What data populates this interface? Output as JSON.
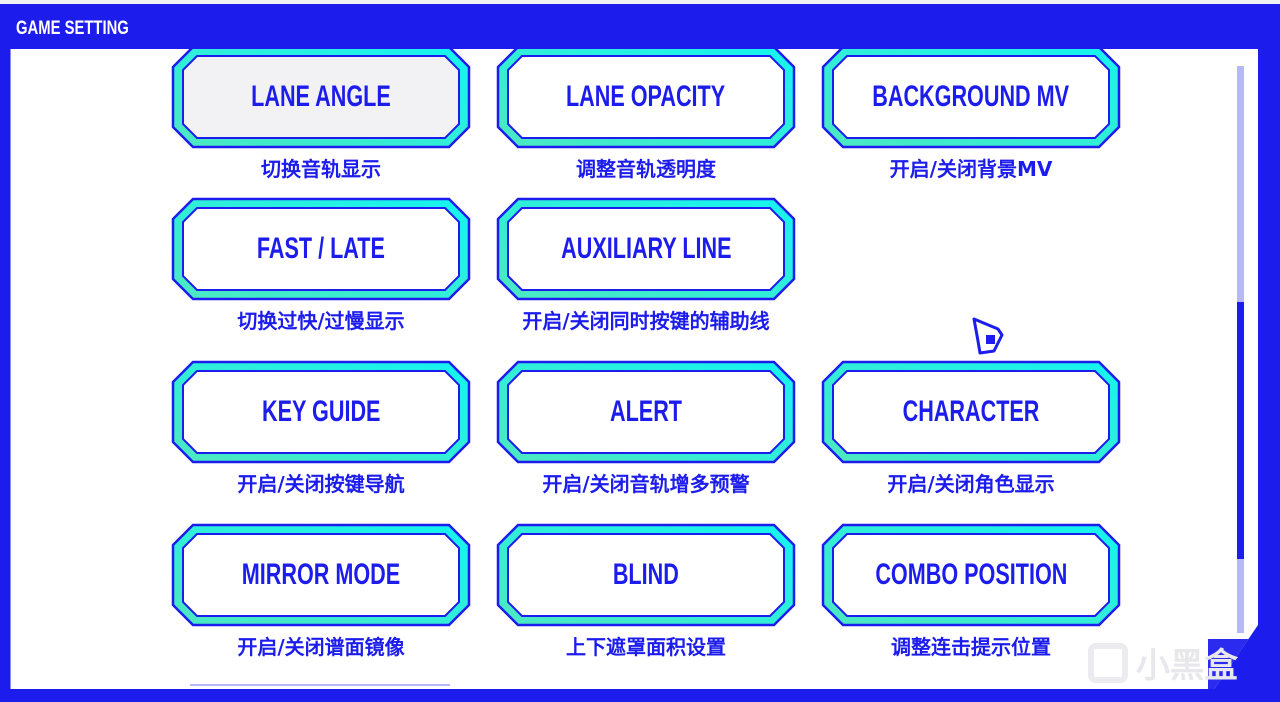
{
  "window": {
    "title": "GAME SETTING"
  },
  "colors": {
    "accent": "#1c1cec",
    "cyan": "#14f4f0",
    "teal": "#4de8c0",
    "scroll_track": "#b6b8fb",
    "selected_fill": "#f2f2f4"
  },
  "settings": [
    {
      "label": "LANE ANGLE",
      "desc": "切换音轨显示",
      "selected": true
    },
    {
      "label": "LANE OPACITY",
      "desc": "调整音轨透明度",
      "selected": false
    },
    {
      "label": "BACKGROUND MV",
      "desc": "开启/关闭背景MV",
      "selected": false
    },
    {
      "label": "FAST / LATE",
      "desc": "切换过快/过慢显示",
      "selected": false
    },
    {
      "label": "AUXILIARY LINE",
      "desc": "开启/关闭同时按键的辅助线",
      "selected": false
    },
    {
      "label": "KEY GUIDE",
      "desc": "开启/关闭按键导航",
      "selected": false
    },
    {
      "label": "ALERT",
      "desc": "开启/关闭音轨增多预警",
      "selected": false
    },
    {
      "label": "CHARACTER",
      "desc": "开启/关闭角色显示",
      "selected": false
    },
    {
      "label": "MIRROR MODE",
      "desc": "开启/关闭谱面镜像",
      "selected": false
    },
    {
      "label": "BLIND",
      "desc": "上下遮罩面积设置",
      "selected": false
    },
    {
      "label": "COMBO POSITION",
      "desc": "调整连击提示位置",
      "selected": false
    }
  ],
  "scrollbar": {
    "position_fraction": 0.42,
    "visible_fraction": 0.45
  },
  "watermark": {
    "text": "小黑盒"
  }
}
